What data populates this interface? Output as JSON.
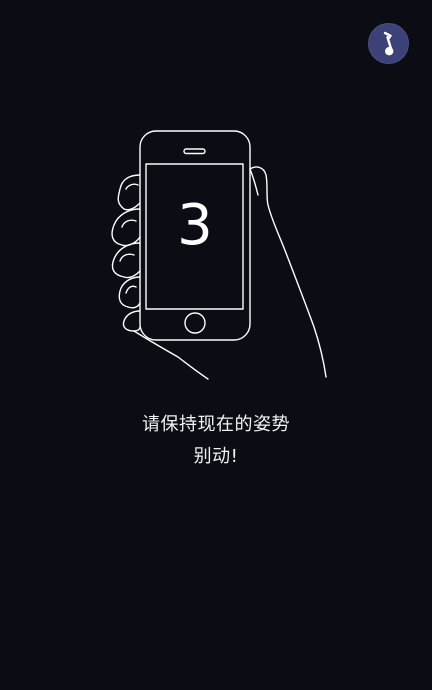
{
  "countdown": {
    "value": "3"
  },
  "message": {
    "line1": "请保持现在的姿势",
    "line2": "别动!"
  },
  "icons": {
    "corner": "music-note-icon",
    "illustration": "hand-holding-phone-icon"
  },
  "colors": {
    "background": "#0b0c14",
    "button": "#3c4278",
    "foreground": "#ffffff"
  }
}
